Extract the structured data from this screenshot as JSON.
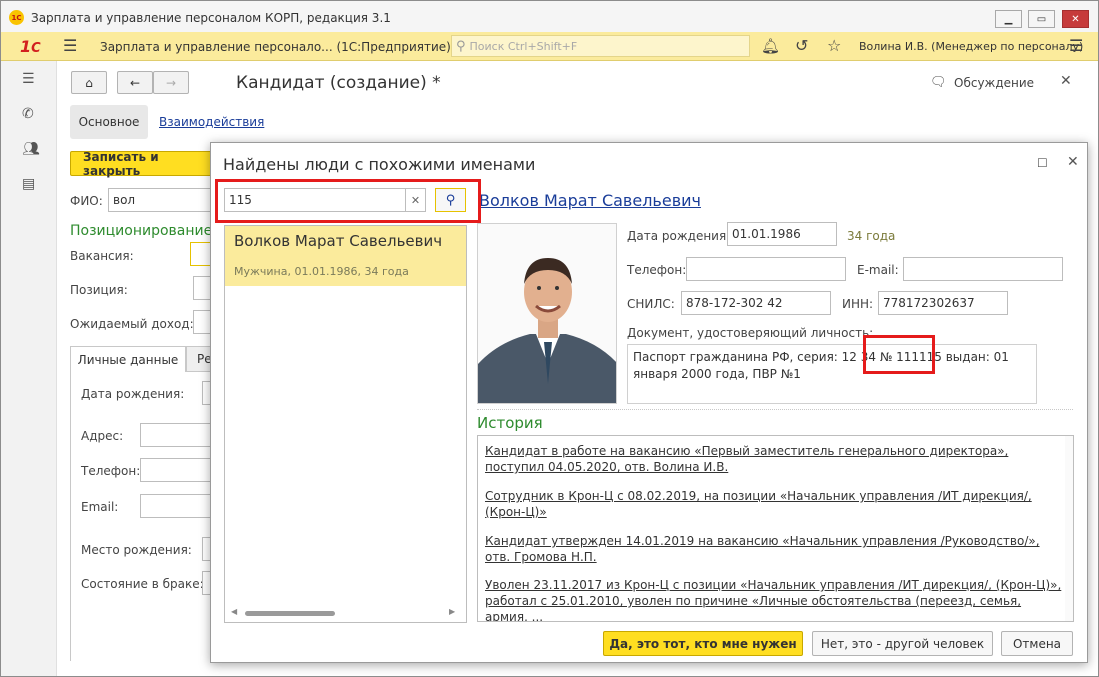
{
  "window": {
    "title": "Зарплата и управление персоналом КОРП, редакция 3.1"
  },
  "toolbar": {
    "app_title": "Зарплата и управление персонало... (1С:Предприятие)",
    "search_placeholder": "Поиск Ctrl+Shift+F",
    "user": "Волина И.В. (Менеджер по персоналу)"
  },
  "form": {
    "title": "Кандидат (создание) *",
    "discussion": "Обсуждение",
    "tabs": [
      "Основное",
      "Взаимодействия"
    ],
    "save_close": "Записать и закрыть",
    "fio_label": "ФИО:",
    "fio_value": "вол",
    "section_positioning": "Позиционирование",
    "vacancy_label": "Вакансия:",
    "position_label": "Позиция:",
    "income_label": "Ожидаемый доход:",
    "subtabs": [
      "Личные данные",
      "Ре"
    ],
    "birth_label": "Дата рождения:",
    "address_label": "Адрес:",
    "phone_label": "Телефон:",
    "email_label": "Email:",
    "birthplace_label": "Место рождения:",
    "marital_label": "Состояние в браке:"
  },
  "dialog": {
    "title": "Найдены люди с похожими именами",
    "search_value": "115",
    "results": [
      {
        "name": "Волков Марат Савельевич",
        "details": "Мужчина, 01.01.1986, 34 года"
      }
    ],
    "person": {
      "name": "Волков Марат Савельевич",
      "birth_label": "Дата рождения:",
      "birth_value": "01.01.1986",
      "age": "34 года",
      "phone_label": "Телефон:",
      "email_label": "E-mail:",
      "snils_label": "СНИЛС:",
      "snils_value": "878-172-302 42",
      "inn_label": "ИНН:",
      "inn_value": "778172302637",
      "doc_label": "Документ, удостоверяющий личность:",
      "doc_value": "Паспорт гражданина РФ, серия: 12 34 № 111115 выдан: 01 января 2000 года, ПВР №1"
    },
    "history_title": "История",
    "history": [
      "Кандидат в работе на вакансию «Первый заместитель генерального директора», поступил 04.05.2020, отв. Волина И.В.",
      "Сотрудник в Крон-Ц с 08.02.2019, на позиции «Начальник управления /ИТ дирекция/, (Крон-Ц)»",
      "Кандидат утвержден 14.01.2019 на вакансию «Начальник управления /Руководство/», отв. Громова Н.П.",
      "Уволен 23.11.2017 из Крон-Ц с позиции «Начальник управления /ИТ дирекция/, (Крон-Ц)», работал с 25.01.2010, уволен по причине «Личные обстоятельства (переезд, семья, армия, ..."
    ],
    "btn_yes": "Да, это тот, кто мне нужен",
    "btn_no": "Нет, это - другой человек",
    "btn_cancel": "Отмена"
  }
}
